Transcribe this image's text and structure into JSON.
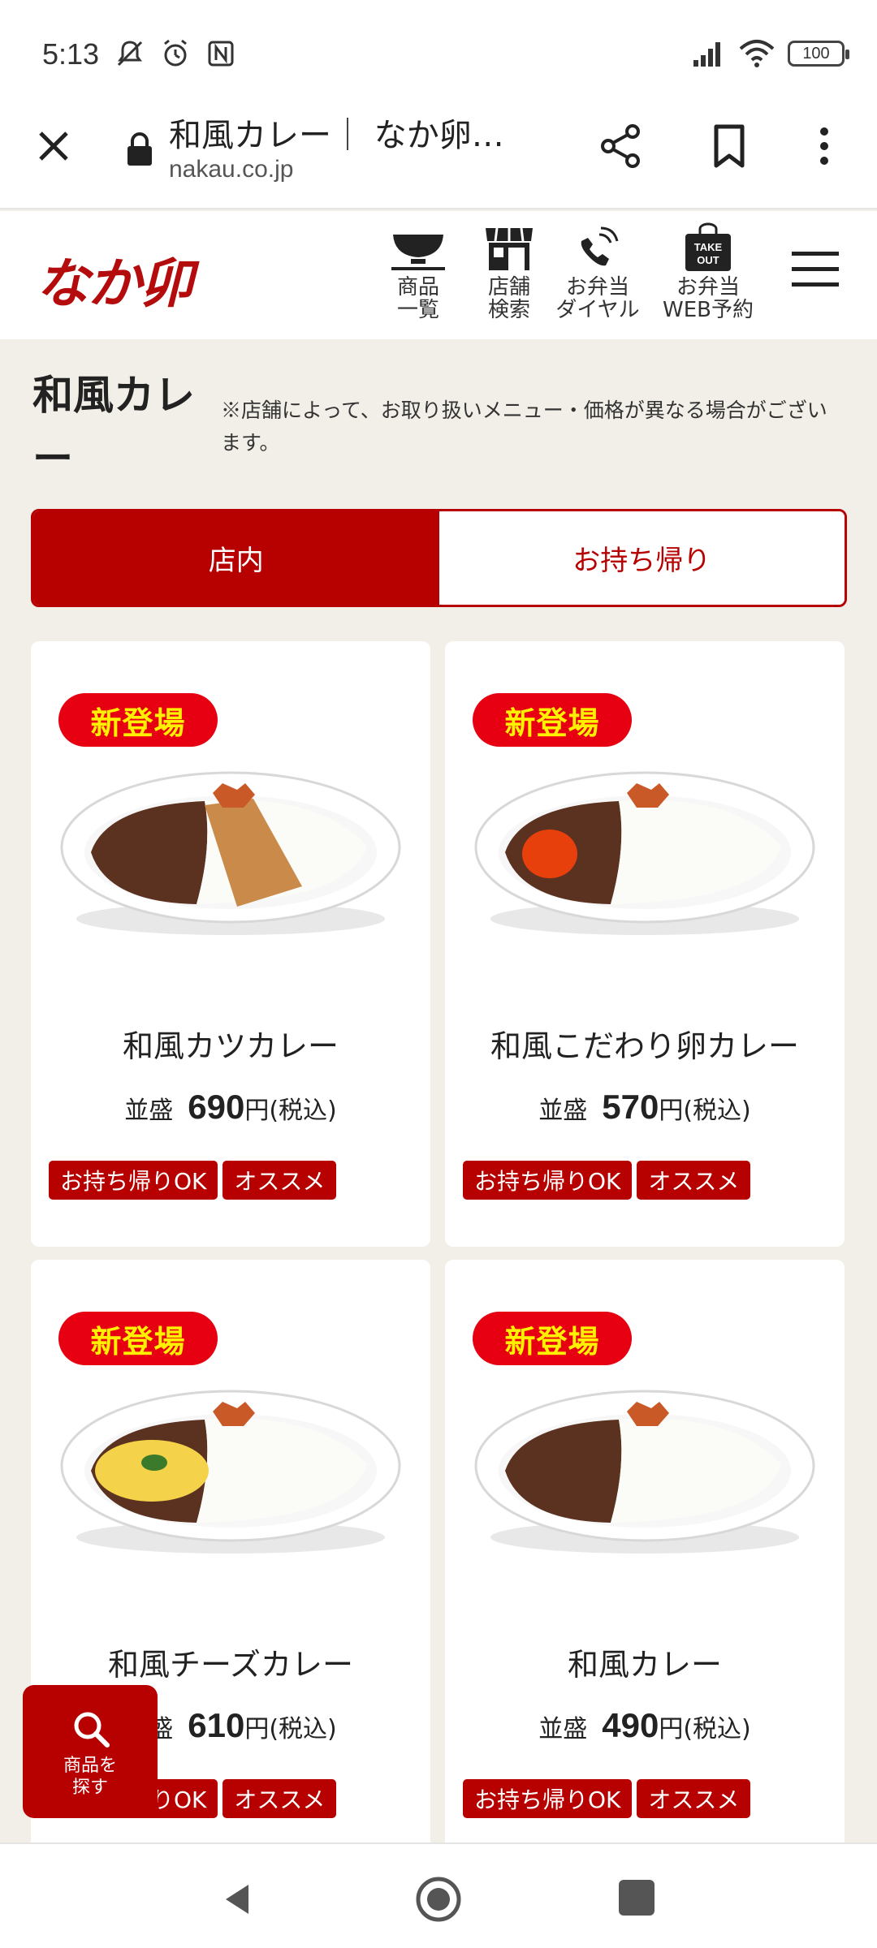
{
  "status_bar": {
    "time": "5:13",
    "battery": "100"
  },
  "browser": {
    "page_title": "和風カレー｜ なか卵…",
    "domain": "nakau.co.jp"
  },
  "site": {
    "logo_text": "なか卯",
    "nav": [
      {
        "label": "商品\n一覧",
        "icon": "bowl-icon"
      },
      {
        "label": "店舗\n検索",
        "icon": "store-icon"
      },
      {
        "label": "お弁当\nダイヤル",
        "icon": "phone-icon"
      },
      {
        "label": "お弁当\nWEB予約",
        "icon": "takeout-bag-icon",
        "icon_text": "TAKE\nOUT"
      }
    ]
  },
  "page": {
    "title": "和風カレー",
    "notice": "※店舗によって、お取り扱いメニュー・価格が異なる場合がございます。"
  },
  "tabs": [
    {
      "label": "店内",
      "active": true
    },
    {
      "label": "お持ち帰り",
      "active": false
    }
  ],
  "products": [
    {
      "badge": "新登場",
      "name": "和風カツカレー",
      "size": "並盛",
      "price": "690",
      "price_suffix": "円(税込)",
      "tags": [
        "お持ち帰りOK",
        "オススメ"
      ],
      "topping": "katsu"
    },
    {
      "badge": "新登場",
      "name": "和風こだわり卵カレー",
      "size": "並盛",
      "price": "570",
      "price_suffix": "円(税込)",
      "tags": [
        "お持ち帰りOK",
        "オススメ"
      ],
      "topping": "egg"
    },
    {
      "badge": "新登場",
      "name": "和風チーズカレー",
      "size": "並盛",
      "price": "610",
      "price_suffix": "円(税込)",
      "tags": [
        "お持ち帰りOK",
        "オススメ"
      ],
      "topping": "cheese"
    },
    {
      "badge": "新登場",
      "name": "和風カレー",
      "size": "並盛",
      "price": "490",
      "price_suffix": "円(税込)",
      "tags": [
        "お持ち帰りOK",
        "オススメ"
      ],
      "topping": "none"
    }
  ],
  "fab": {
    "label": "商品を\n探す"
  },
  "colors": {
    "brand_red": "#b70000",
    "badge_red": "#e60012",
    "badge_text": "#ffef00",
    "background": "#f2efe8"
  }
}
